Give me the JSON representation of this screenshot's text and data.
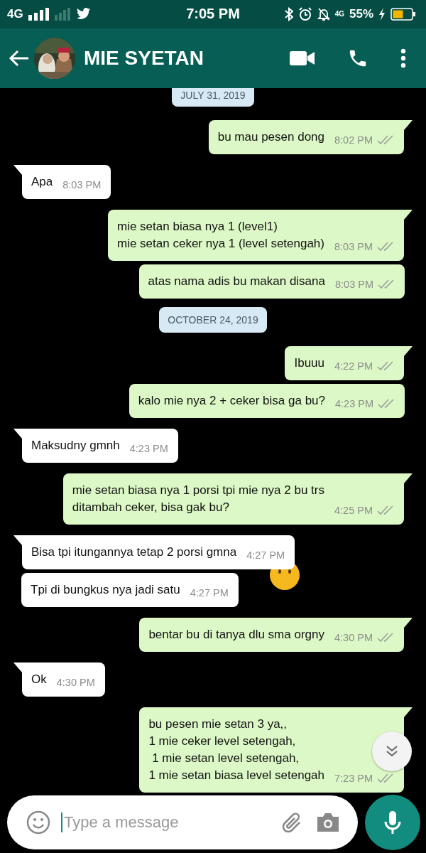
{
  "status_bar": {
    "network": "4G",
    "time": "7:05 PM",
    "data_badge": "4G",
    "battery": "55%"
  },
  "header": {
    "contact_name": "MIE SYETAN"
  },
  "messages": [
    {
      "kind": "date",
      "text": "JULY 31, 2019"
    },
    {
      "kind": "out",
      "text": "bu mau pesen dong",
      "time": "8:02 PM",
      "tail": true
    },
    {
      "kind": "in",
      "text": "Apa",
      "time": "8:03 PM",
      "tail": true
    },
    {
      "kind": "out",
      "text": "mie setan biasa nya 1 (level1)\nmie setan ceker nya 1 (level setengah)",
      "time": "8:03 PM",
      "tail": true
    },
    {
      "kind": "out",
      "text": "atas nama adis bu makan disana",
      "time": "8:03 PM",
      "tail": false
    },
    {
      "kind": "date",
      "text": "OCTOBER 24, 2019"
    },
    {
      "kind": "out",
      "text": "Ibuuu",
      "time": "4:22 PM",
      "tail": true
    },
    {
      "kind": "out",
      "text": "kalo mie nya 2 + ceker bisa ga bu?",
      "time": "4:23 PM",
      "tail": false
    },
    {
      "kind": "in",
      "text": "Maksudny gmnh",
      "time": "4:23 PM",
      "tail": true
    },
    {
      "kind": "out",
      "text": "mie setan biasa nya 1 porsi tpi mie nya 2 bu trs\nditambah ceker, bisa gak bu?",
      "time": "4:25 PM",
      "tail": true
    },
    {
      "kind": "in",
      "text": "Bisa tpi itungannya tetap 2 porsi gmna",
      "time": "4:27 PM",
      "tail": true
    },
    {
      "kind": "in",
      "text": "Tpi di bungkus nya jadi satu",
      "time": "4:27 PM",
      "tail": false
    },
    {
      "kind": "out",
      "text": "bentar bu di tanya dlu sma orgny",
      "time": "4:30 PM",
      "tail": true
    },
    {
      "kind": "in",
      "text": "Ok",
      "time": "4:30 PM",
      "tail": true
    },
    {
      "kind": "out",
      "text": "bu pesen mie setan 3 ya,,\n1 mie ceker level setengah,\n 1 mie setan level setengah,\n1 mie setan biasa level setengah",
      "time": "7:23 PM",
      "tail": true
    }
  ],
  "composer": {
    "placeholder": "Type a message"
  }
}
